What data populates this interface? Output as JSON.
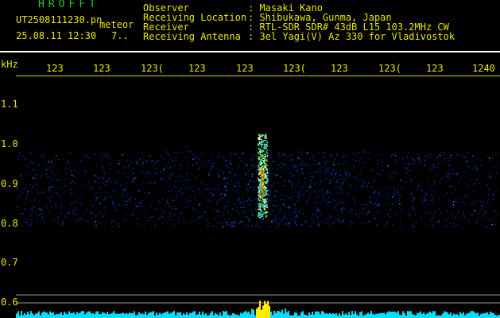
{
  "header": {
    "program": "HROFFT",
    "filename": "UT2508111230.pn",
    "mode": "meteor",
    "datetime": "25.08.11 12:30",
    "count": "7..",
    "fields": [
      {
        "label": "Observer",
        "value": ": Masaki Kano"
      },
      {
        "label": "Receiving Location",
        "value": ": Shibukawa, Gunma, Japan"
      },
      {
        "label": "Receiver",
        "value": ": RTL-SDR SDR# 43dB L15 103.2MHz CW"
      },
      {
        "label": "Receiving Antenna",
        "value": ": 3el Yagi(V) Az 330 for Vladivostok"
      }
    ]
  },
  "axes": {
    "y_unit": "kHz",
    "y_ticks": [
      "1.1",
      "1.0",
      "0.9",
      "0.8",
      "0.7",
      "0.6"
    ],
    "x_ticks": [
      "123",
      "123",
      "123(",
      "123",
      "123",
      "123(",
      "123",
      "123(",
      "123",
      "1240"
    ]
  },
  "colors": {
    "background": "#000000",
    "text": "#e8e800",
    "title": "#20d020",
    "noise": "#1838d8",
    "signal": "#ffee00",
    "level_trace": "#00e0ff"
  }
}
